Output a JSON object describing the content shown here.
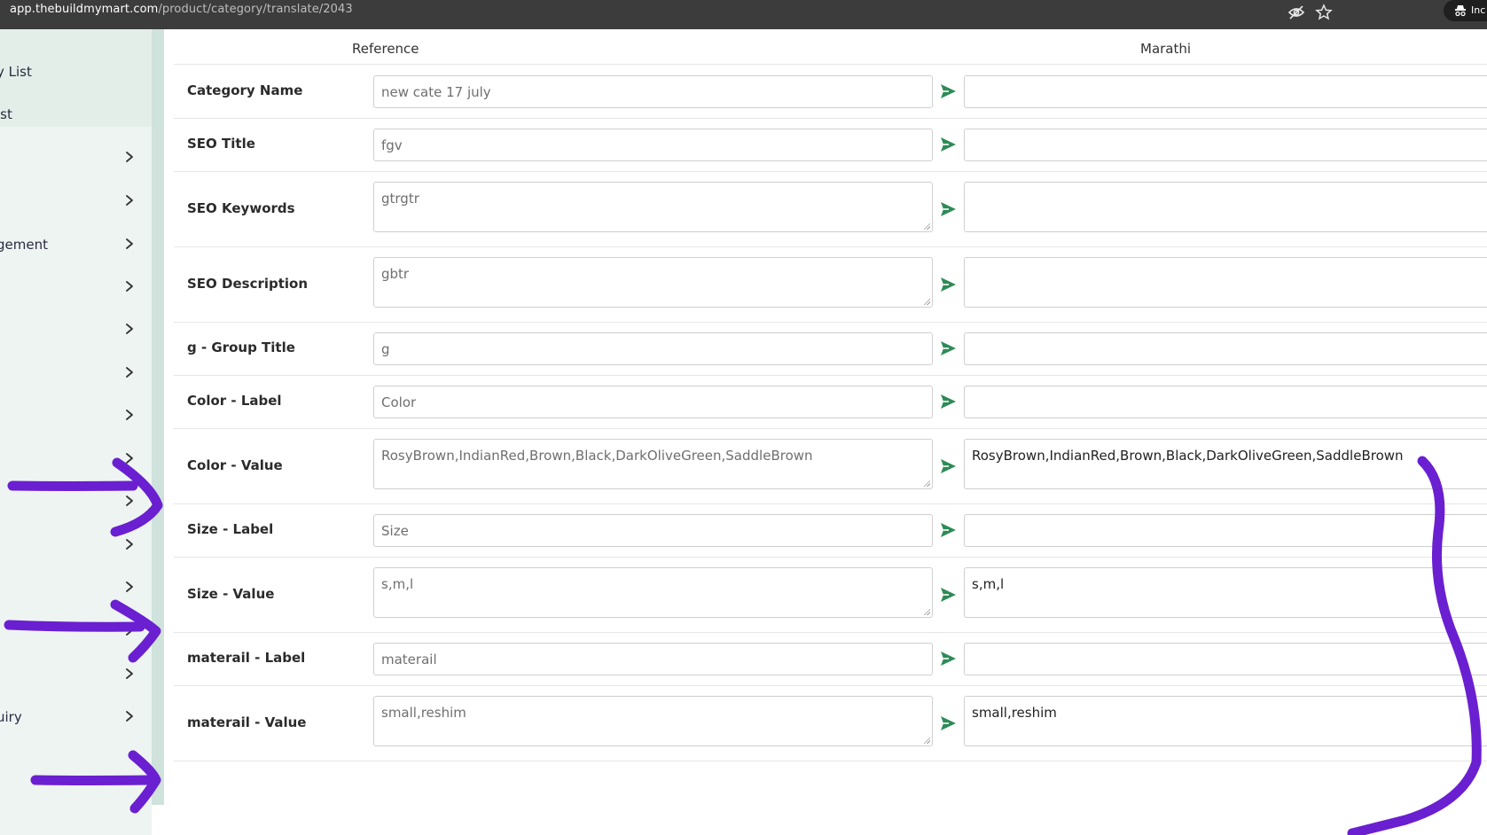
{
  "browser": {
    "url_host": "app.thebuildmymart.com",
    "url_path": "/product/category/translate/2043",
    "profile_text": "Inc"
  },
  "sidebar": {
    "items": [
      {
        "label": "y List"
      },
      {
        "label": "ist"
      },
      {
        "label": ""
      },
      {
        "label": ""
      },
      {
        "label": "gement"
      },
      {
        "label": ""
      },
      {
        "label": ""
      },
      {
        "label": ""
      },
      {
        "label": ""
      },
      {
        "label": ""
      },
      {
        "label": ""
      },
      {
        "label": ""
      },
      {
        "label": ""
      },
      {
        "label": ""
      },
      {
        "label": ""
      },
      {
        "label": "uiry"
      }
    ]
  },
  "table": {
    "reference_header": "Reference",
    "language_header": "Marathi",
    "rows": [
      {
        "label": "Category Name",
        "reference": "new cate 17 july",
        "translation": ""
      },
      {
        "label": "SEO Title",
        "reference": "fgv",
        "translation": ""
      },
      {
        "label": "SEO Keywords",
        "reference": "gtrgtr",
        "translation": ""
      },
      {
        "label": "SEO Description",
        "reference": "gbtr",
        "translation": ""
      },
      {
        "label": "g - Group Title",
        "reference": "g",
        "translation": ""
      },
      {
        "label": "Color - Label",
        "reference": "Color",
        "translation": ""
      },
      {
        "label": "Color - Value",
        "reference": "RosyBrown,IndianRed,Brown,Black,DarkOliveGreen,SaddleBrown",
        "translation": "RosyBrown,IndianRed,Brown,Black,DarkOliveGreen,SaddleBrown"
      },
      {
        "label": "Size - Label",
        "reference": "Size",
        "translation": ""
      },
      {
        "label": "Size - Value",
        "reference": "s,m,l",
        "translation": "s,m,l"
      },
      {
        "label": "materail - Label",
        "reference": "materail",
        "translation": ""
      },
      {
        "label": "materail - Value",
        "reference": "small,reshim",
        "translation": "small,reshim"
      }
    ]
  },
  "colors": {
    "browser_bar": "#3c3c3c",
    "sidebar_bg": "#edf4f2",
    "send_icon": "#2e8b57",
    "annotation": "#6a1fd1"
  }
}
